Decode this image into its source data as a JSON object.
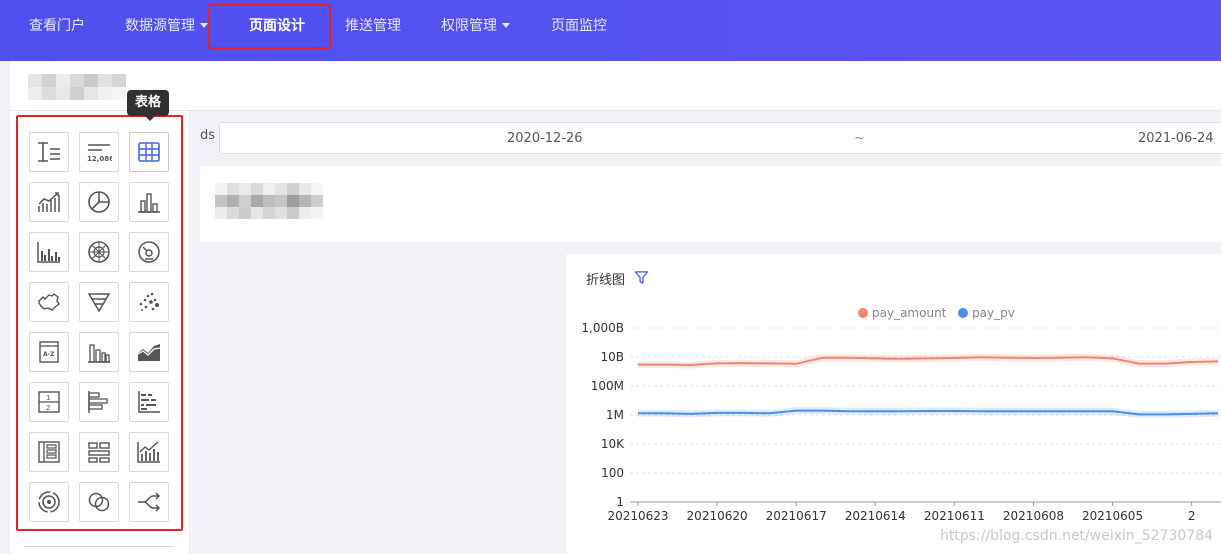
{
  "nav": {
    "items": [
      {
        "label": "查看门户",
        "dropdown": false,
        "active": false
      },
      {
        "label": "数据源管理",
        "dropdown": true,
        "active": false
      },
      {
        "label": "页面设计",
        "dropdown": false,
        "active": true
      },
      {
        "label": "推送管理",
        "dropdown": false,
        "active": false
      },
      {
        "label": "权限管理",
        "dropdown": true,
        "active": false
      },
      {
        "label": "页面监控",
        "dropdown": false,
        "active": false
      }
    ]
  },
  "tooltip": {
    "text": "表格"
  },
  "components": [
    {
      "icon": "text-icon"
    },
    {
      "icon": "number-icon"
    },
    {
      "icon": "table-icon"
    },
    {
      "icon": "line-chart-icon"
    },
    {
      "icon": "pie-chart-icon"
    },
    {
      "icon": "bar-chart-icon"
    },
    {
      "icon": "grouped-bar-icon"
    },
    {
      "icon": "radar-icon"
    },
    {
      "icon": "gauge-icon"
    },
    {
      "icon": "china-map-icon"
    },
    {
      "icon": "funnel-icon"
    },
    {
      "icon": "scatter-icon"
    },
    {
      "icon": "word-cloud-icon"
    },
    {
      "icon": "column-icon"
    },
    {
      "icon": "area-chart-icon"
    },
    {
      "icon": "fraction-icon"
    },
    {
      "icon": "horizontal-bar-icon"
    },
    {
      "icon": "stacked-horizontal-bar-icon"
    },
    {
      "icon": "layout-icon"
    },
    {
      "icon": "grid-layout-icon"
    },
    {
      "icon": "combo-chart-icon"
    },
    {
      "icon": "ring-icon"
    },
    {
      "icon": "venn-icon"
    },
    {
      "icon": "sankey-icon"
    }
  ],
  "filter": {
    "label": "ds",
    "start": "2020-12-26",
    "separator": "~",
    "end": "2021-06-24"
  },
  "chart_title": "折线图",
  "chart_data": {
    "type": "line",
    "yscale": "log",
    "ylim": [
      1,
      1000000000000
    ],
    "yticks": [
      {
        "value": 1,
        "label": "1"
      },
      {
        "value": 100,
        "label": "100"
      },
      {
        "value": 10000,
        "label": "10K"
      },
      {
        "value": 1000000,
        "label": "1M"
      },
      {
        "value": 100000000,
        "label": "100M"
      },
      {
        "value": 10000000000,
        "label": "10B"
      },
      {
        "value": 1000000000000,
        "label": "1,000B"
      }
    ],
    "xticks": [
      "20210623",
      "20210620",
      "20210617",
      "20210614",
      "20210611",
      "20210608",
      "20210605",
      "2"
    ],
    "legend_position": "top",
    "series": [
      {
        "name": "pay_amount",
        "color": "#f08672",
        "values": [
          3000000000,
          3000000000,
          2800000000,
          3600000000,
          3800000000,
          3600000000,
          3400000000,
          9000000000,
          9000000000,
          8000000000,
          7500000000,
          8000000000,
          8500000000,
          9500000000,
          9000000000,
          8500000000,
          9000000000,
          9500000000,
          8000000000,
          3500000000,
          3500000000,
          4500000000,
          5000000000
        ]
      },
      {
        "name": "pay_pv",
        "color": "#4a8eee",
        "values": [
          1300000,
          1300000,
          1200000,
          1400000,
          1400000,
          1300000,
          2000000,
          2000000,
          1800000,
          1800000,
          1800000,
          1900000,
          1900000,
          1800000,
          1800000,
          1800000,
          1800000,
          1800000,
          1800000,
          1100000,
          1100000,
          1200000,
          1300000
        ]
      }
    ]
  },
  "watermark": "https://blog.csdn.net/weixin_52730784"
}
